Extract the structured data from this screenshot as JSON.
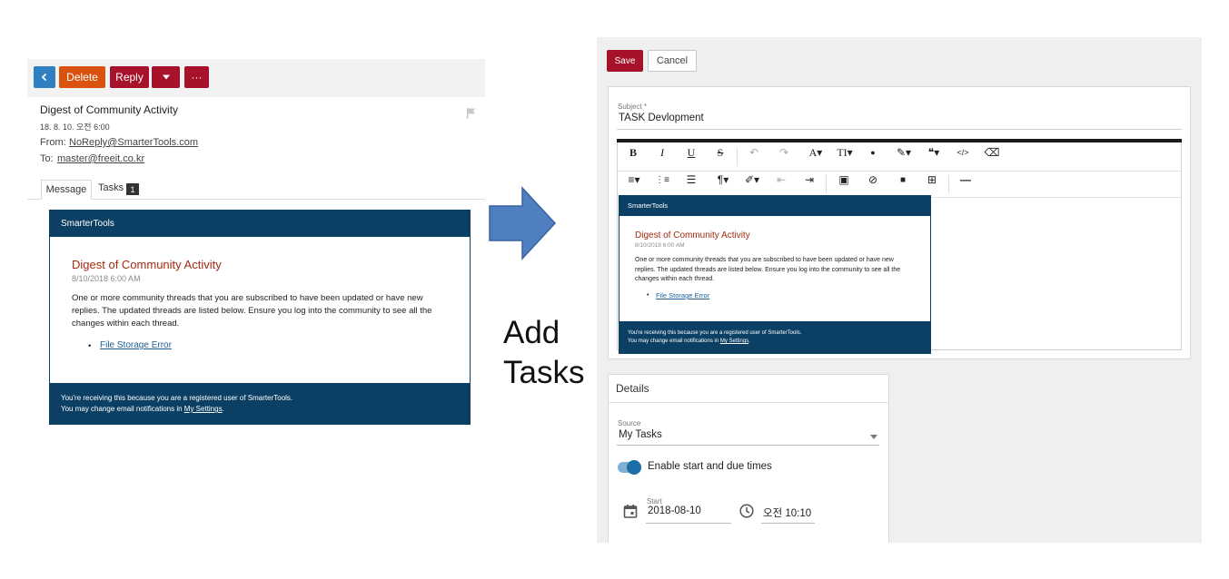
{
  "left": {
    "toolbar": {
      "back_icon": "chevron-left-icon",
      "delete_label": "Delete",
      "reply_label": "Reply",
      "reply_dropdown_icon": "caret-down-icon",
      "more_label": "···"
    },
    "message": {
      "subject": "Digest of Community Activity",
      "date": "18. 8. 10. 오전 6:00",
      "from_label": "From:",
      "from": "NoReply@SmarterTools.com",
      "to_label": "To:",
      "to": "master@freeit.co.kr"
    },
    "tabs": [
      {
        "label": "Message",
        "active": true
      },
      {
        "label": "Tasks",
        "badge": "1"
      }
    ],
    "email": {
      "brand": "SmarterTools",
      "title": "Digest of Community Activity",
      "date": "8/10/2018 6:00 AM",
      "body": "One or more community threads that you are subscribed to have been updated or have new replies. The updated threads are listed below. Ensure you log into the community to see all the changes within each thread.",
      "link": "File Storage Error",
      "footer_line1": "You're receiving this because you are a registered user of SmarterTools.",
      "footer_line2_prefix": "You may change email notifications in ",
      "footer_settings_link": "My Settings",
      "footer_line2_suffix": "."
    }
  },
  "middle": {
    "add_tasks": "Add Tasks"
  },
  "right": {
    "toolbar": {
      "save_label": "Save",
      "cancel_label": "Cancel"
    },
    "subject": {
      "label": "Subject *",
      "value": "TASK Devlopment"
    },
    "editor_tools_row1": [
      "B",
      "I",
      "U",
      "S",
      "↶",
      "↷",
      "A▾",
      "TI▾",
      "●",
      "✎▾",
      "❝▾",
      "</>",
      "⌫"
    ],
    "editor_tools_row2": [
      "≡▾",
      "⋮≡",
      "☰",
      "¶▾",
      "✐▾",
      "⇤",
      "⇥",
      "▣",
      "⊘",
      "■",
      "⊞",
      "—"
    ],
    "email": {
      "brand": "SmarterTools",
      "title": "Digest of Community Activity",
      "date": "8/10/2018 6:00 AM",
      "body": "One or more community threads that you are subscribed to have been updated or have new replies. The updated threads are listed below. Ensure you log into the community to see all the changes within each thread.",
      "link": "File Storage Error",
      "footer_line1": "You're receiving this because you are a registered user of SmarterTools.",
      "footer_line2_prefix": "You may change email notifications in ",
      "footer_settings_link": "My Settings",
      "footer_line2_suffix": "."
    },
    "details": {
      "title": "Details",
      "source_label": "Source",
      "source_value": "My Tasks",
      "toggle_label": "Enable start and due times",
      "toggle_on": true,
      "start_label": "Start",
      "start_date": "2018-08-10",
      "start_time": "오전 10:10"
    }
  },
  "colors": {
    "primary_red": "#a5122a",
    "delete_orange": "#d9530f",
    "back_blue": "#2f7fc1",
    "email_navy": "#0b4064",
    "title_red": "#a32a10",
    "link_blue": "#1d5f9a",
    "arrow_blue": "#4f7fc0"
  }
}
